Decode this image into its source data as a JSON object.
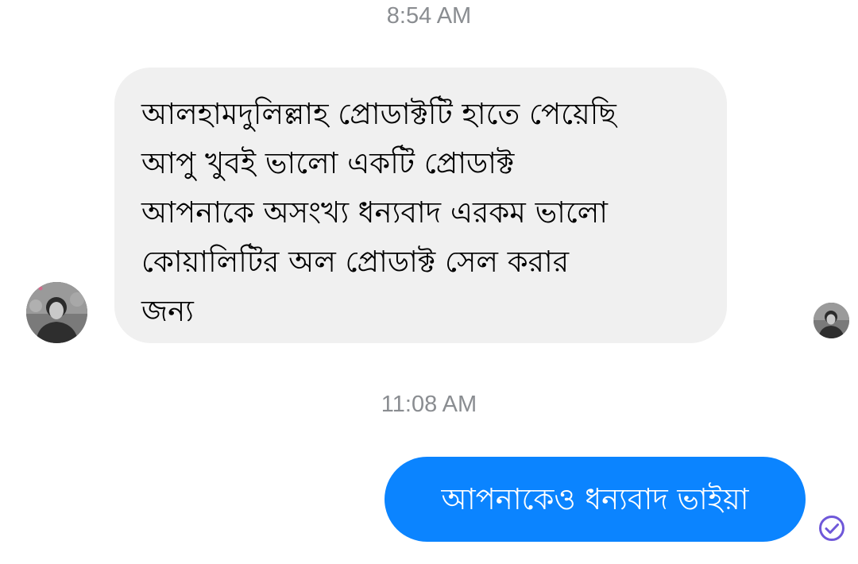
{
  "conversation": {
    "timestamps": [
      "8:54 AM",
      "11:08 AM"
    ],
    "incoming_message": {
      "lines": [
        "আলহামদুলিল্লাহ প্রোডাক্টটি হাতে পেয়েছি",
        "আপু খুবই ভালো একটি প্রোডাক্ট",
        "আপনাকে অসংখ্য ধন্যবাদ এরকম ভালো",
        "কোয়ালিটির অল প্রোডাক্ট  সেল  করার",
        "জন্য"
      ],
      "bubble_color": "#f0f0f0"
    },
    "outgoing_message": {
      "text": "আপনাকেও ধন্যবাদ ভাইয়া",
      "bubble_color": "#0b84ff"
    },
    "sender_avatar_icon": "profile-photo",
    "seen_avatar_icon": "profile-photo",
    "status_icon": "sent-check-circle-icon",
    "status_color": "#6f58d9"
  }
}
